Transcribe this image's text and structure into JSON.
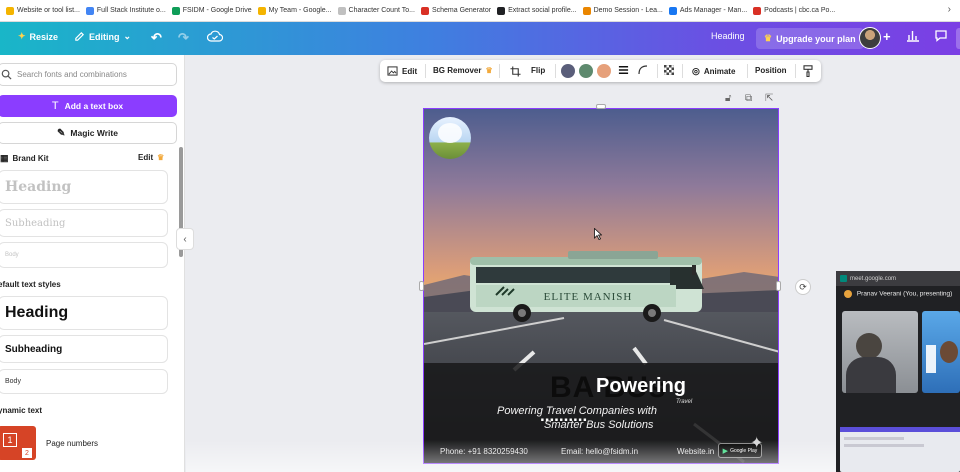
{
  "bookmarks": [
    {
      "label": "Website or tool list...",
      "color": "#f4b400"
    },
    {
      "label": "Full Stack Institute o...",
      "color": "#4285f4"
    },
    {
      "label": "FSIDM - Google Drive",
      "color": "#0f9d58"
    },
    {
      "label": "My Team - Google...",
      "color": "#f4b400"
    },
    {
      "label": "Character Count To...",
      "color": "#e0e0e0"
    },
    {
      "label": "Schema Generator",
      "color": "#d93025"
    },
    {
      "label": "Extract social profile...",
      "color": "#202124"
    },
    {
      "label": "Demo Session - Lea...",
      "color": "#ea8600"
    },
    {
      "label": "Ads Manager - Man...",
      "color": "#1877f2"
    },
    {
      "label": "Podcasts | cbc.ca Po...",
      "color": "#d93025"
    }
  ],
  "toolbar": {
    "resize_label": "Resize",
    "editing_label": "Editing",
    "heading_label": "Heading",
    "upgrade_label": "Upgrade your plan"
  },
  "sidebar": {
    "search_placeholder": "Search fonts and combinations",
    "add_text_label": "Add a text box",
    "magic_write_label": "Magic Write",
    "brand_kit_label": "Brand Kit",
    "brand_edit_label": "Edit",
    "brand_heading": "Heading",
    "brand_subheading": "Subheading",
    "brand_body": "Body",
    "default_styles_label": "efault text styles",
    "default_heading": "Heading",
    "default_subheading": "Subheading",
    "default_body": "Body",
    "dynamic_text_label": "ynamic text",
    "page_numbers_label": "Page numbers",
    "page_numbers_icon_digit": "1",
    "page_numbers_icon_badge": "2"
  },
  "floatbar": {
    "edit_label": "Edit",
    "bg_remover_label": "BG Remover",
    "flip_label": "Flip",
    "animate_label": "Animate",
    "position_label": "Position",
    "swatches": [
      "#5a5e7a",
      "#5e8a6e",
      "#e6a07a"
    ]
  },
  "design": {
    "bus_name": "ELITE MANISH",
    "title_black": "BA BUs",
    "title_white": "Powering",
    "subtitle_line1": "Powering Travel Companies with",
    "subtitle_overlay": "..........",
    "subtitle_line2": "Smarter Bus Solutions",
    "travel_tag": "Travel",
    "phone": "Phone: +91 8320259430",
    "email": "Email: hello@fsidm.in",
    "website": "Website.in",
    "gplay_label": "Google Play"
  },
  "meet": {
    "url": "meet.google.com",
    "presenter": "Pranav Veerani (You, presenting)"
  }
}
